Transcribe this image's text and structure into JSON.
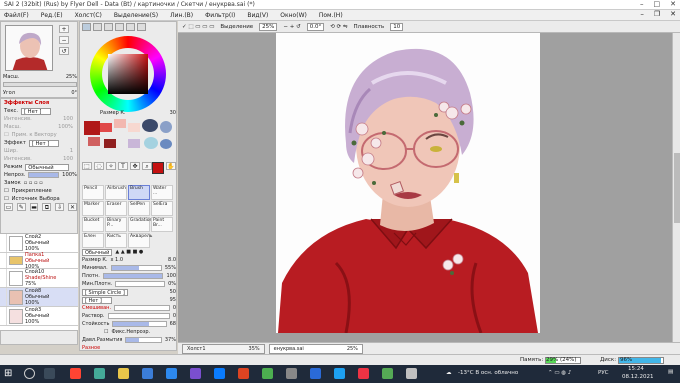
{
  "window": {
    "title": "SAI 2 (32bit) (Rus) by Flyer Dell - Data (Bt) / картиночки / Скетчи / енукрва.sai (*)"
  },
  "menu": [
    "Файл(F)",
    "Ред.(E)",
    "Холст(C)",
    "Выделение(S)",
    "Лин.(B)",
    "Фильтр(I)",
    "Вид(V)",
    "Окно(W)",
    "Пом.(H)"
  ],
  "navigator": {
    "zoom_label": "Масш.",
    "zoom_value": "25%",
    "angle_label": "Угол",
    "angle_value": "0°"
  },
  "layer_props": {
    "effects_title": "Эффекты Слоя",
    "texture_label": "Текс.",
    "texture_value": "[ Нет ]",
    "intensity_label": "Интенсив.",
    "intensity_value": "100",
    "scale_label": "Масш.",
    "scale_value": "100%",
    "as_vector_label": "Прим. к Вектору",
    "effect_label": "Эффект",
    "effect_value": "[ Нет ]",
    "width_label": "Шир.",
    "width_value": "1",
    "intensity2_label": "Интенсив.",
    "intensity2_value": "100",
    "mode_label": "Режим",
    "mode_value": "Обычный",
    "opacity_label": "Непроз.",
    "opacity_value": "100%",
    "lock_label": "Замок",
    "clipping_label": "Прикрепление",
    "selection_src_label": "Источник Выбора"
  },
  "layers": [
    {
      "name": "Слой2",
      "mode": "Обычный",
      "opacity": "100%"
    },
    {
      "name": "Папка1",
      "mode": "Обычный",
      "opacity": "100%"
    },
    {
      "name": "Слой10",
      "mode": "Shade/Shine",
      "opacity": "75%"
    },
    {
      "name": "Слой8",
      "mode": "Обычный",
      "opacity": "100%"
    },
    {
      "name": "Слой3",
      "mode": "Обычный",
      "opacity": "100%"
    }
  ],
  "brush_size_row": {
    "label": "Размер К.",
    "value": "30"
  },
  "brushes": [
    {
      "name": "Pencil"
    },
    {
      "name": "Airbrush"
    },
    {
      "name": "Brush"
    },
    {
      "name": "Water ..."
    },
    {
      "name": "Marker"
    },
    {
      "name": "Eraser"
    },
    {
      "name": "SelPen"
    },
    {
      "name": "SelEra"
    },
    {
      "name": "Bucket"
    },
    {
      "name": "Binary P..."
    },
    {
      "name": "Gradation"
    },
    {
      "name": "Paint Br..."
    },
    {
      "name": "Блен"
    },
    {
      "name": "Кисть"
    },
    {
      "name": "Акварель"
    }
  ],
  "brush_props": {
    "mode": "Обычный",
    "size_label": "Размер К.",
    "size_mult": "x 1.0",
    "size_value": "8.0",
    "min_label": "Минимал.",
    "min_value": "55%",
    "density_label": "Плотн.",
    "density_value": "100",
    "min_density_label": "Мин.Плотн.",
    "min_density_value": "0%",
    "shape_value": "[ Simple Circle ]",
    "shape_num": "50",
    "texture_value": "[ Нет ]",
    "texture_num": "95",
    "blend_title": "Смешиван.",
    "blend_value": "0",
    "dilution_label": "Раствор.",
    "dilution_value": "0",
    "persist_label": "Стойкость",
    "persist_value": "68",
    "fix_opacity_label": "Фикс.Непрозр.",
    "blur_label": "Давл.Размытия",
    "blur_value": "37%",
    "advanced_label": "Разное"
  },
  "toolbar": {
    "selection_label": "Выделение",
    "zoom": "25%",
    "angle": "0.0°",
    "stabilizer_label": "Плавность",
    "stabilizer_value": "10"
  },
  "tabs": [
    {
      "name": "Холст1",
      "zoom": "35%"
    },
    {
      "name": "енукрва.sai",
      "zoom": "25%"
    }
  ],
  "status": {
    "memory_label": "Память:",
    "memory_value": "29%",
    "memory_value2": "(24%)",
    "disk_label": "Диск:",
    "disk_value": "96%"
  },
  "taskbar": {
    "weather": "-13°C  В осн. облачно",
    "lang": "РУС",
    "time": "15:24",
    "date": "08.12.2021"
  },
  "colors": {
    "accent": "#c41010",
    "selected": "#cfd8f6"
  }
}
